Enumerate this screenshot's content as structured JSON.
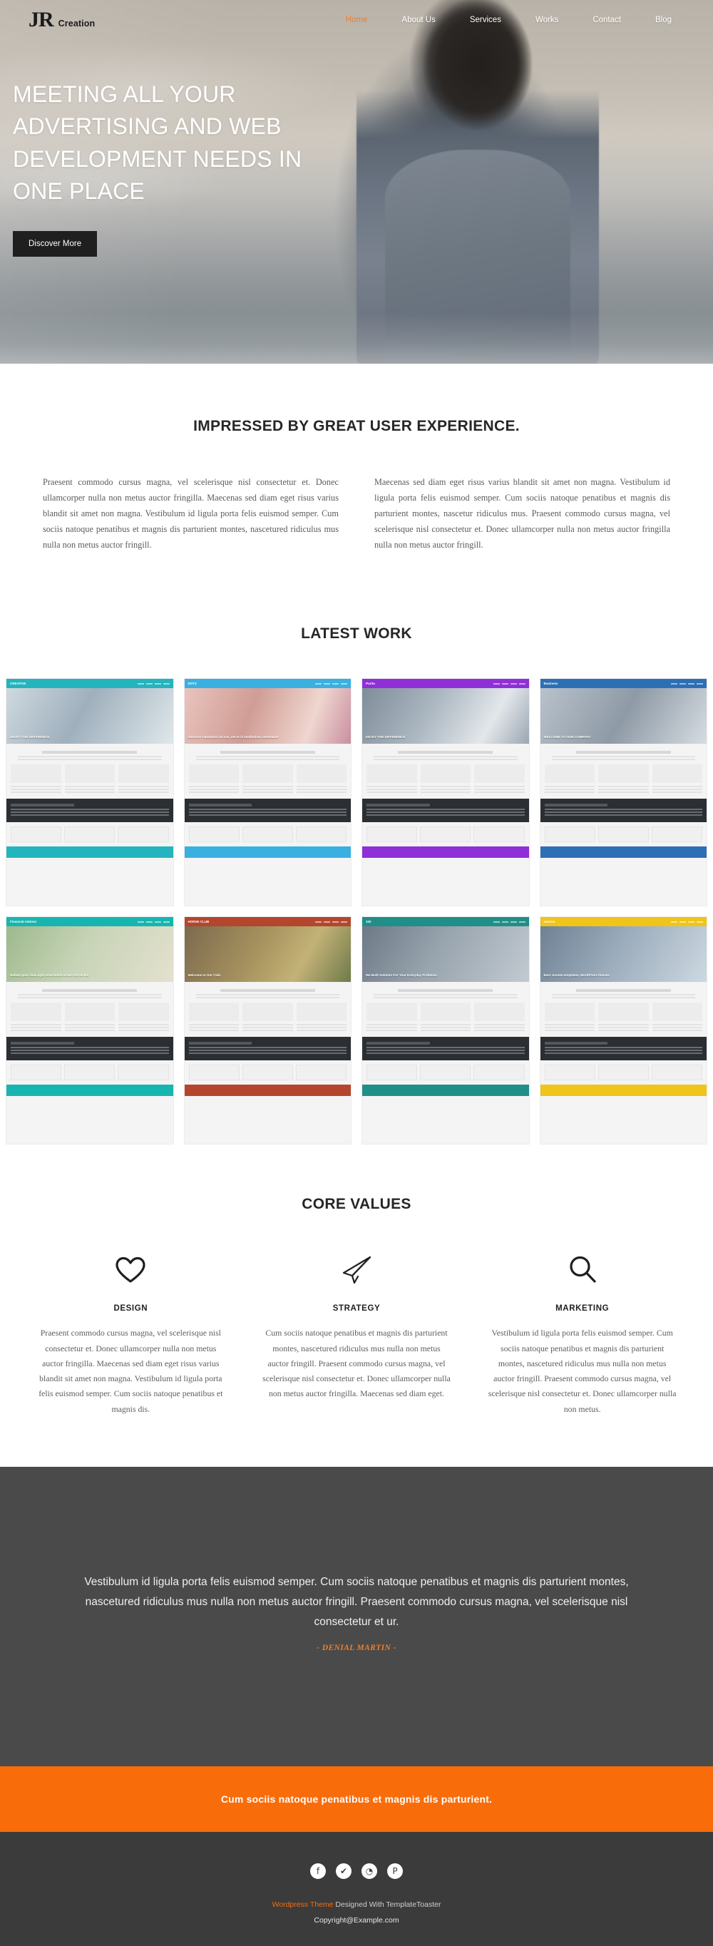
{
  "nav": {
    "brand_mark": "JR",
    "brand_name": "Creation",
    "items": [
      {
        "label": "Home",
        "active": true
      },
      {
        "label": "About Us",
        "active": false
      },
      {
        "label": "Services",
        "active": false
      },
      {
        "label": "Works",
        "active": false
      },
      {
        "label": "Contact",
        "active": false
      },
      {
        "label": "Blog",
        "active": false
      }
    ]
  },
  "hero": {
    "title": "MEETING ALL YOUR ADVERTISING AND WEB DEVELOPMENT NEEDS IN ONE PLACE",
    "button": "Discover More"
  },
  "impressed": {
    "title": "IMPRESSED BY GREAT USER EXPERIENCE.",
    "left": "Praesent commodo cursus magna, vel scelerisque nisl consectetur et. Donec ullamcorper nulla non metus auctor fringilla. Maecenas sed diam eget risus varius blandit sit amet non magna. Vestibulum id ligula porta felis euismod semper. Cum sociis natoque penatibus et magnis dis parturient montes, nascetured ridiculus mus nulla non metus auctor fringill.",
    "right": "Maecenas sed diam eget risus varius blandit sit amet non magna. Vestibulum id ligula porta felis euismod semper. Cum sociis natoque penatibus et magnis dis parturient montes, nascetur ridiculus mus. Praesent commodo cursus magna, vel scelerisque nisl consectetur et. Donec ullamcorper nulla non metus auctor fringilla nulla non metus auctor fringill."
  },
  "work": {
    "title": "LATEST WORK",
    "items": [
      {
        "label": "CREATIVE",
        "accent": "#23b4bd",
        "hero": "business-man-portrait",
        "headline": "ENJOY THE DIFFERENCE."
      },
      {
        "label": "DOTZ",
        "accent": "#39b0e0",
        "hero": "smiling-woman-photo",
        "headline": "Discover reputation ad nos, est et id vestibulum contentare"
      },
      {
        "label": "Purito",
        "accent": "#8e2fd8",
        "hero": "laptop-on-desk",
        "headline": "ENJOY THE DIFFERENCE"
      },
      {
        "label": "Business",
        "accent": "#2d6fb5",
        "hero": "business-team-meeting",
        "headline": "WELCOME TO OUR COMPANY"
      },
      {
        "label": "Financial Advisor",
        "accent": "#17b5b0",
        "hero": "woman-with-phone",
        "headline": "Nullam quis risus eget urna mollis ornare vel eu leo"
      },
      {
        "label": "HORSE CLUB",
        "accent": "#b4462e",
        "hero": "horse-rider-field",
        "headline": "Welcome to Our Club"
      },
      {
        "label": "100",
        "accent": "#1f8f87",
        "hero": "city-road-photo",
        "headline": "We Built Solution For Your Everyday Problems"
      },
      {
        "label": "metrics",
        "accent": "#f0c419",
        "hero": "city-skyline-photo",
        "headline": "Best Joomla templates, WordPress themes"
      }
    ]
  },
  "core": {
    "title": "CORE VALUES",
    "items": [
      {
        "icon": "heart-icon",
        "name": "DESIGN",
        "text": "Praesent commodo cursus magna, vel scelerisque nisl consectetur et. Donec ullamcorper nulla non metus auctor fringilla. Maecenas sed diam eget risus varius blandit sit amet non magna. Vestibulum id ligula porta felis euismod semper. Cum sociis natoque penatibus et magnis dis."
      },
      {
        "icon": "paper-plane-icon",
        "name": "STRATEGY",
        "text": "Cum sociis natoque penatibus et magnis dis parturient montes, nascetured ridiculus mus nulla non metus auctor fringill. Praesent commodo cursus magna, vel scelerisque nisl consectetur et. Donec ullamcorper nulla non metus auctor fringilla. Maecenas sed diam eget."
      },
      {
        "icon": "magnifier-icon",
        "name": "MARKETING",
        "text": "Vestibulum id ligula porta felis euismod semper. Cum sociis natoque penatibus et magnis dis parturient montes, nascetured ridiculus mus nulla non metus auctor fringill. Praesent commodo cursus magna, vel scelerisque nisl consectetur et. Donec ullamcorper nulla non metus."
      }
    ]
  },
  "quote": {
    "text": "Vestibulum id ligula porta felis euismod semper. Cum sociis natoque penatibus et magnis dis parturient montes, nascetured ridiculus mus nulla non metus auctor fringill. Praesent commodo cursus magna, vel scelerisque nisl consectetur et ur.",
    "author": "- DENIAL MARTIN -"
  },
  "cta": {
    "text": "Cum sociis natoque penatibus et magnis dis parturient."
  },
  "footer": {
    "socials": [
      {
        "name": "facebook-icon",
        "glyph": "f"
      },
      {
        "name": "twitter-icon",
        "glyph": "✔"
      },
      {
        "name": "rss-icon",
        "glyph": "◔"
      },
      {
        "name": "pinterest-icon",
        "glyph": "P"
      }
    ],
    "credit_prefix": "Wordpress Theme",
    "credit_suffix": " Designed With TemplateToaster",
    "copyright": "Copyright@Example.com"
  },
  "colors": {
    "accent_orange": "#f96c0a",
    "nav_active": "#ef7f2b",
    "quote_bg": "#4a4a4a",
    "footer_bg": "#3b3b3b"
  }
}
